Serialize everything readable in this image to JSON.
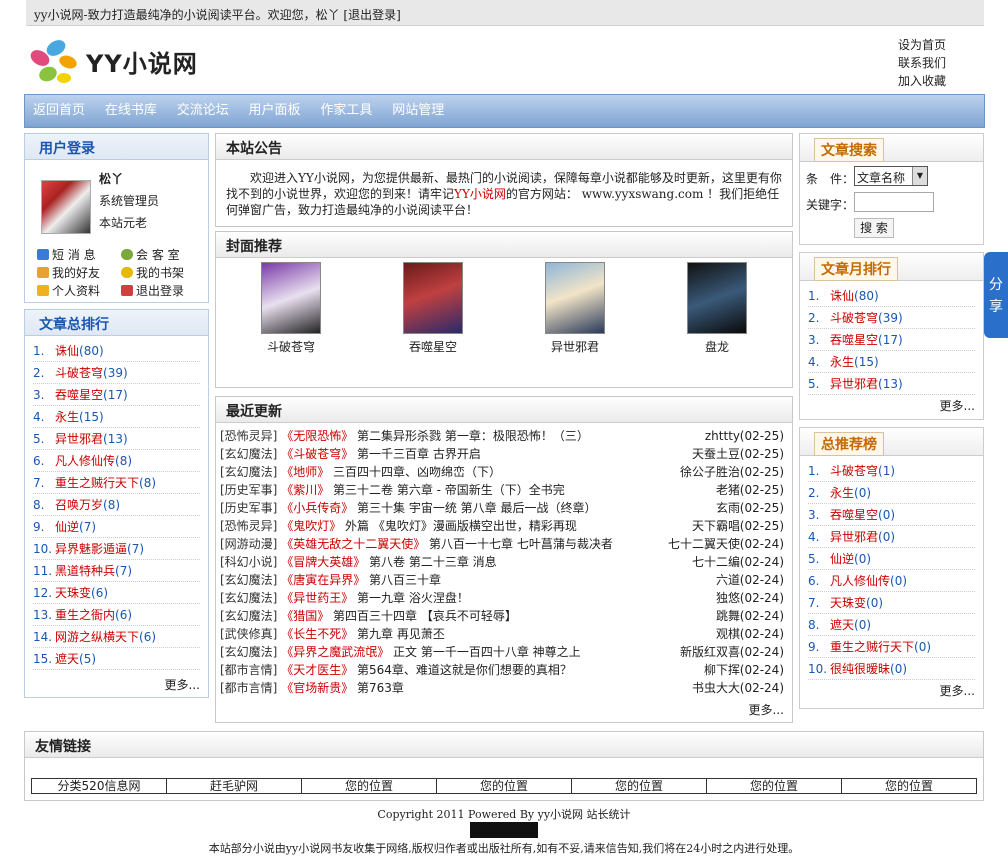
{
  "topbar": {
    "text": "yy小说网-致力打造最纯净的小说阅读平台。欢迎您，松丫 [退出登录]"
  },
  "logo": {
    "text": "YY小说网"
  },
  "toplinks": [
    "设为首页",
    "联系我们",
    "加入收藏"
  ],
  "nav": [
    "返回首页",
    "在线书库",
    "交流论坛",
    "用户面板",
    "作家工具",
    "网站管理"
  ],
  "login": {
    "title": "用户登录",
    "name": "松丫",
    "role": "系统管理员",
    "rank": "本站元老",
    "links": [
      "短 消 息",
      "会 客 室",
      "我的好友",
      "我的书架",
      "个人资料",
      "退出登录"
    ]
  },
  "total_rank": {
    "title": "文章总排行",
    "items": [
      {
        "n": "1.",
        "t": "诛仙",
        "c": "(80)"
      },
      {
        "n": "2.",
        "t": "斗破苍穹",
        "c": "(39)"
      },
      {
        "n": "3.",
        "t": "吞噬星空",
        "c": "(17)"
      },
      {
        "n": "4.",
        "t": "永生",
        "c": "(15)"
      },
      {
        "n": "5.",
        "t": "异世邪君",
        "c": "(13)"
      },
      {
        "n": "6.",
        "t": "凡人修仙传",
        "c": "(8)"
      },
      {
        "n": "7.",
        "t": "重生之贼行天下",
        "c": "(8)"
      },
      {
        "n": "8.",
        "t": "召唤万岁",
        "c": "(8)"
      },
      {
        "n": "9.",
        "t": "仙逆",
        "c": "(7)"
      },
      {
        "n": "10.",
        "t": "异界魅影遁逼",
        "c": "(7)"
      },
      {
        "n": "11.",
        "t": "黑道特种兵",
        "c": "(7)"
      },
      {
        "n": "12.",
        "t": "天珠变",
        "c": "(6)"
      },
      {
        "n": "13.",
        "t": "重生之衙内",
        "c": "(6)"
      },
      {
        "n": "14.",
        "t": "网游之纵横天下",
        "c": "(6)"
      },
      {
        "n": "15.",
        "t": "遮天",
        "c": "(5)"
      }
    ],
    "more": "更多..."
  },
  "notice": {
    "title": "本站公告",
    "text1": "欢迎进入YY小说网，为您提供最新、最热门的小说阅读，保障每章小说都能够及时更新，这里更有你找不到的小说世界，欢迎您的到来！请牢记",
    "site": "YY小说网",
    "text2": "的官方网站： www.yyxswang.com ！我们拒绝任何弹窗广告，致力打造最纯净的小说阅读平台！"
  },
  "covers": {
    "title": "封面推荐",
    "items": [
      "斗破苍穹",
      "吞噬星空",
      "异世邪君",
      "盘龙"
    ]
  },
  "updates": {
    "title": "最近更新",
    "rows": [
      {
        "cat": "[恐怖灵异]",
        "book": "《无限恐怖》",
        "ch": "第二集异形杀戮 第一章：极限恐怖！（三）",
        "a": "zhttty",
        "d": "(02-25)"
      },
      {
        "cat": "[玄幻魔法]",
        "book": "《斗破苍穹》",
        "ch": "第一千三百章 古界开启",
        "a": "天蚕土豆",
        "d": "(02-25)"
      },
      {
        "cat": "[玄幻魔法]",
        "book": "《地师》",
        "ch": "三百四十四章、凶吻绵峦（下）",
        "a": "徐公子胜治",
        "d": "(02-25)"
      },
      {
        "cat": "[历史军事]",
        "book": "《紫川》",
        "ch": "第三十二卷 第六章 - 帝国新生（下）全书完",
        "a": "老猪",
        "d": "(02-25)"
      },
      {
        "cat": "[历史军事]",
        "book": "《小兵传奇》",
        "ch": "第三十集 宇宙一统 第八章 最后一战（终章）",
        "a": "玄雨",
        "d": "(02-25)"
      },
      {
        "cat": "[恐怖灵异]",
        "book": "《鬼吹灯》",
        "ch": "外篇 《鬼吹灯》漫画版横空出世，精彩再现",
        "a": "天下霸唱",
        "d": "(02-25)"
      },
      {
        "cat": "[网游动漫]",
        "book": "《英雄无敌之十二翼天使》",
        "ch": "第八百一十七章 七叶菖蒲与裁决者",
        "a": "七十二翼天使",
        "d": "(02-24)"
      },
      {
        "cat": "[科幻小说]",
        "book": "《冒牌大英雄》",
        "ch": "第八卷 第二十三章 消息",
        "a": "七十二编",
        "d": "(02-24)"
      },
      {
        "cat": "[玄幻魔法]",
        "book": "《唐寅在异界》",
        "ch": "第八百三十章",
        "a": "六道",
        "d": "(02-24)"
      },
      {
        "cat": "[玄幻魔法]",
        "book": "《异世药王》",
        "ch": "第一九章 浴火涅盘！",
        "a": "独悠",
        "d": "(02-24)"
      },
      {
        "cat": "[玄幻魔法]",
        "book": "《猎国》",
        "ch": "第四百三十四章 【哀兵不可轻辱】",
        "a": "跳舞",
        "d": "(02-24)"
      },
      {
        "cat": "[武侠修真]",
        "book": "《长生不死》",
        "ch": "第九章 再见萧丕",
        "a": "观棋",
        "d": "(02-24)"
      },
      {
        "cat": "[玄幻魔法]",
        "book": "《异界之魔武流氓》",
        "ch": "正文 第一千一百四十八章 神尊之上",
        "a": "新版红双喜",
        "d": "(02-24)"
      },
      {
        "cat": "[都市言情]",
        "book": "《天才医生》",
        "ch": "第564章、难道这就是你们想要的真相？",
        "a": "柳下挥",
        "d": "(02-24)"
      },
      {
        "cat": "[都市言情]",
        "book": "《官场新贵》",
        "ch": "第763章",
        "a": "书虫大大",
        "d": "(02-24)"
      }
    ],
    "more": "更多..."
  },
  "search": {
    "title": "文章搜索",
    "cond_label": "条　件：",
    "cond_value": "文章名称",
    "key_label": "关键字：",
    "btn": "搜 索"
  },
  "month_rank": {
    "title": "文章月排行",
    "items": [
      {
        "n": "1.",
        "t": "诛仙",
        "c": "(80)"
      },
      {
        "n": "2.",
        "t": "斗破苍穹",
        "c": "(39)"
      },
      {
        "n": "3.",
        "t": "吞噬星空",
        "c": "(17)"
      },
      {
        "n": "4.",
        "t": "永生",
        "c": "(15)"
      },
      {
        "n": "5.",
        "t": "异世邪君",
        "c": "(13)"
      }
    ],
    "more": "更多..."
  },
  "rec_rank": {
    "title": "总推荐榜",
    "items": [
      {
        "n": "1.",
        "t": "斗破苍穹",
        "c": "(1)"
      },
      {
        "n": "2.",
        "t": "永生",
        "c": "(0)"
      },
      {
        "n": "3.",
        "t": "吞噬星空",
        "c": "(0)"
      },
      {
        "n": "4.",
        "t": "异世邪君",
        "c": "(0)"
      },
      {
        "n": "5.",
        "t": "仙逆",
        "c": "(0)"
      },
      {
        "n": "6.",
        "t": "凡人修仙传",
        "c": "(0)"
      },
      {
        "n": "7.",
        "t": "天珠变",
        "c": "(0)"
      },
      {
        "n": "8.",
        "t": "遮天",
        "c": "(0)"
      },
      {
        "n": "9.",
        "t": "重生之贼行天下",
        "c": "(0)"
      },
      {
        "n": "10.",
        "t": "很纯很暧昧",
        "c": "(0)"
      }
    ],
    "more": "更多..."
  },
  "share": {
    "text1": "分",
    "text2": "享"
  },
  "friends": {
    "title": "友情链接",
    "links": [
      "分类520信息网",
      "赶毛驴网",
      "您的位置",
      "您的位置",
      "您的位置",
      "您的位置",
      "您的位置"
    ]
  },
  "footer": {
    "copyright": "Copyright 2011 Powered By yy小说网 站长统计",
    "notice": "本站部分小说由yy小说网书友收集于网络,版权归作者或出版社所有,如有不妥,请来信告知,我们将在24小时之内进行处理。"
  }
}
